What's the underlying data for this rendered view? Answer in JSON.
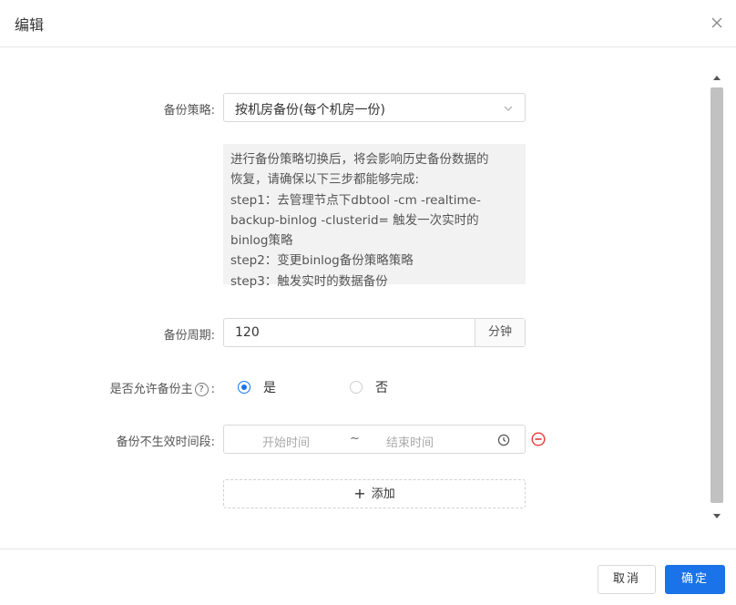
{
  "dialog": {
    "title": "编辑"
  },
  "form": {
    "strategy": {
      "label": "备份策略:",
      "value": "按机房备份(每个机房一份)"
    },
    "notice": {
      "lines": [
        "进行备份策略切换后，将会影响历史备份数据的",
        "恢复，请确保以下三步都能够完成:",
        "step1：去管理节点下dbtool -cm -realtime-",
        "backup-binlog -clusterid= 触发一次实时的",
        "binlog策略",
        "step2：变更binlog备份策略策略",
        "step3：触发实时的数据备份"
      ]
    },
    "cycle": {
      "label": "备份周期:",
      "value": "120",
      "unit": "分钟"
    },
    "allow_master": {
      "label": "是否允许备份主",
      "help": "?",
      "colon": ":",
      "options": [
        "是",
        "否"
      ],
      "selected": "是"
    },
    "no_effect_period": {
      "label": "备份不生效时间段:",
      "start_placeholder": "开始时间",
      "separator": "~",
      "end_placeholder": "结束时间"
    },
    "add_label": "添加",
    "add_plus": "+"
  },
  "footer": {
    "cancel": "取消",
    "ok": "确定"
  },
  "colors": {
    "primary": "#1a73e8",
    "danger": "#e53935",
    "notice_bg": "#f2f2f2"
  }
}
